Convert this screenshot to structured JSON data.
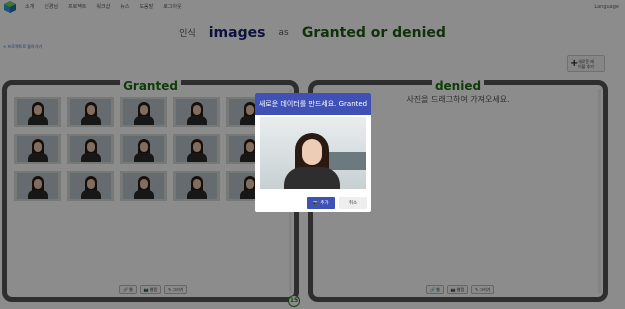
{
  "nav": {
    "items": [
      "소개",
      "신경님",
      "프로젝트",
      "워크샵",
      "뉴스",
      "도움말",
      "로그아웃"
    ],
    "language": "Language"
  },
  "header": {
    "prefix": "인식",
    "subject": "images",
    "conjunction": "as",
    "labels": "Granted or denied"
  },
  "back_link": "< 프로젝트로 돌아가기",
  "add_label_button": {
    "line1": "새로운 레",
    "line2": "이블 추가"
  },
  "panels": {
    "left": {
      "title": "Granted",
      "buttons": [
        "웹",
        "웹캠",
        "그리기"
      ]
    },
    "right": {
      "title": "denied",
      "hint": "사진을 드래그하여 가져오세요.",
      "buttons": [
        "웹",
        "웹캠",
        "그리기"
      ]
    }
  },
  "counter": "15",
  "modal": {
    "title": "새로운 데이터를 만드세요. Granted",
    "add_label": "추가",
    "cancel_label": "취소"
  },
  "colors": {
    "accent": "#3f51b5",
    "label_green": "#1d6e12",
    "header_blue": "#1a1f6e"
  }
}
